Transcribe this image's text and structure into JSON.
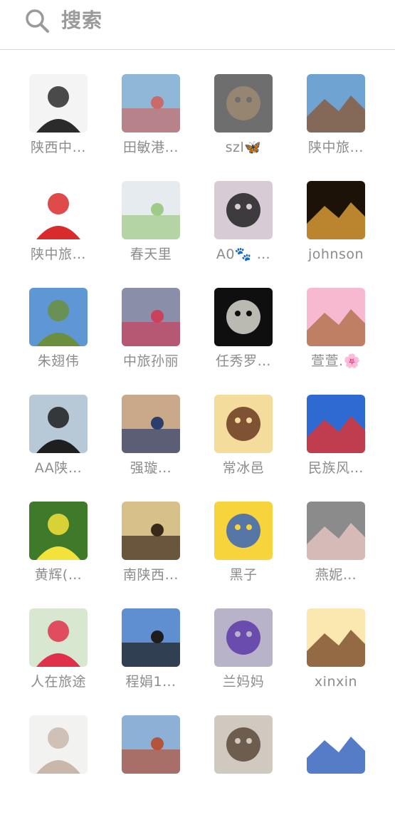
{
  "search": {
    "placeholder": "搜索",
    "icon": "search-icon"
  },
  "contacts": [
    {
      "name": "陕西中…",
      "avatar": "man-portrait",
      "colors": [
        "#f4f4f4",
        "#2b2b2b"
      ]
    },
    {
      "name": "田敏港…",
      "avatar": "woman-mountain-lake",
      "colors": [
        "#8fb8d8",
        "#c96b6b"
      ]
    },
    {
      "name": "szl🦋",
      "avatar": "cartoon-bunny",
      "colors": [
        "#6e6e6e",
        "#9c8a72"
      ]
    },
    {
      "name": "陕中旅…",
      "avatar": "city-street-building",
      "colors": [
        "#6fa3d2",
        "#8a5a3b"
      ]
    },
    {
      "name": "陕中旅…",
      "avatar": "logo-feisuqian",
      "colors": [
        "#ffffff",
        "#d92b2b"
      ]
    },
    {
      "name": "春天里",
      "avatar": "cabbage",
      "colors": [
        "#e5ebee",
        "#9fcb88"
      ]
    },
    {
      "name": "A0🐾 …",
      "avatar": "woman-sunglasses",
      "colors": [
        "#d7cbd5",
        "#222222"
      ]
    },
    {
      "name": "johnson",
      "avatar": "night-lights",
      "colors": [
        "#1c1208",
        "#e3a33b"
      ]
    },
    {
      "name": "朱翅伟",
      "avatar": "landscape-village",
      "colors": [
        "#5f97d4",
        "#6b8f3e"
      ]
    },
    {
      "name": "中旅孙丽",
      "avatar": "city-night-street",
      "colors": [
        "#8a8ea8",
        "#c9415c"
      ]
    },
    {
      "name": "任秀罗…",
      "avatar": "snowman-dark",
      "colors": [
        "#0f0f0f",
        "#d8d8d0"
      ]
    },
    {
      "name": "萱萱.🌸",
      "avatar": "brown-bear-pink",
      "colors": [
        "#f6b9cf",
        "#b0704a"
      ]
    },
    {
      "name": "AA陕…",
      "avatar": "woman-harbor",
      "colors": [
        "#b7c8d6",
        "#1f1f1f"
      ]
    },
    {
      "name": "强璇…",
      "avatar": "business-cards",
      "colors": [
        "#c9a98a",
        "#2c3e6b"
      ]
    },
    {
      "name": "常冰邑",
      "avatar": "cartoon-horse",
      "colors": [
        "#f4dc9c",
        "#6b3a22"
      ]
    },
    {
      "name": "民族风…",
      "avatar": "travel-poster",
      "colors": [
        "#2f6ad3",
        "#e3322c"
      ]
    },
    {
      "name": "黄辉(…",
      "avatar": "yellow-flower",
      "colors": [
        "#3f7a2a",
        "#f3e23a"
      ]
    },
    {
      "name": "南陕西…",
      "avatar": "sunset-silhouettes",
      "colors": [
        "#d8c08a",
        "#3a2a1c"
      ]
    },
    {
      "name": "黑子",
      "avatar": "cartoon-face-heart",
      "colors": [
        "#f7d43b",
        "#3a66b8"
      ]
    },
    {
      "name": "燕妮…",
      "avatar": "woman-car",
      "colors": [
        "#8b8b8b",
        "#e9c6c3"
      ]
    },
    {
      "name": "人在旅途",
      "avatar": "child-red-hat",
      "colors": [
        "#d8e8d0",
        "#e0314a"
      ]
    },
    {
      "name": "程娟1…",
      "avatar": "woman-seaside",
      "colors": [
        "#5f8fd1",
        "#1d1d1d"
      ]
    },
    {
      "name": "兰妈妈",
      "avatar": "flower-bouquet",
      "colors": [
        "#b9b3c9",
        "#5b3aa8"
      ]
    },
    {
      "name": "xinxin",
      "avatar": "cartoon-girl",
      "colors": [
        "#fbe8b0",
        "#7a4a2a"
      ]
    },
    {
      "name": "",
      "avatar": "woman-bright",
      "colors": [
        "#f2f2f0",
        "#c9b8aa"
      ]
    },
    {
      "name": "",
      "avatar": "people-market",
      "colors": [
        "#8db0d6",
        "#b4543a"
      ]
    },
    {
      "name": "",
      "avatar": "man-street",
      "colors": [
        "#cfc9c0",
        "#5a4a3a"
      ]
    },
    {
      "name": "",
      "avatar": "business-card-portrait",
      "colors": [
        "#ffffff",
        "#2a5bb8"
      ]
    }
  ]
}
